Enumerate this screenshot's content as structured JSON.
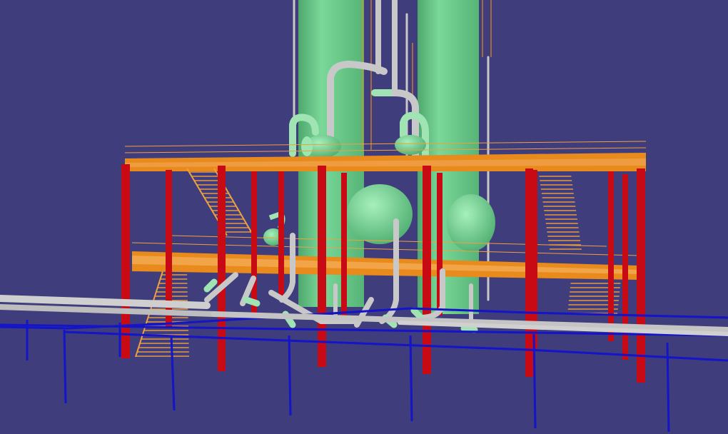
{
  "scene": {
    "kind": "3d-plant-model-viewport",
    "background_color": "#3f3d7c",
    "colors": {
      "column": "#6cc88a",
      "column_shade": "#4ea86e",
      "vessel": "#7fd89a",
      "steel_red": "#c80a14",
      "grating_orange": "#e88a1c",
      "railing_orange": "#f0a040",
      "pipe_gray": "#b8b8b8",
      "pipe_fitting_green": "#8fe0a6",
      "pipe_rack_blue": "#1414c8"
    },
    "objects": [
      "twin-distillation-columns",
      "two-level-platform-structure",
      "horizontal-drums",
      "spherical-vessels",
      "stairways",
      "pipe-rack",
      "piping"
    ]
  }
}
